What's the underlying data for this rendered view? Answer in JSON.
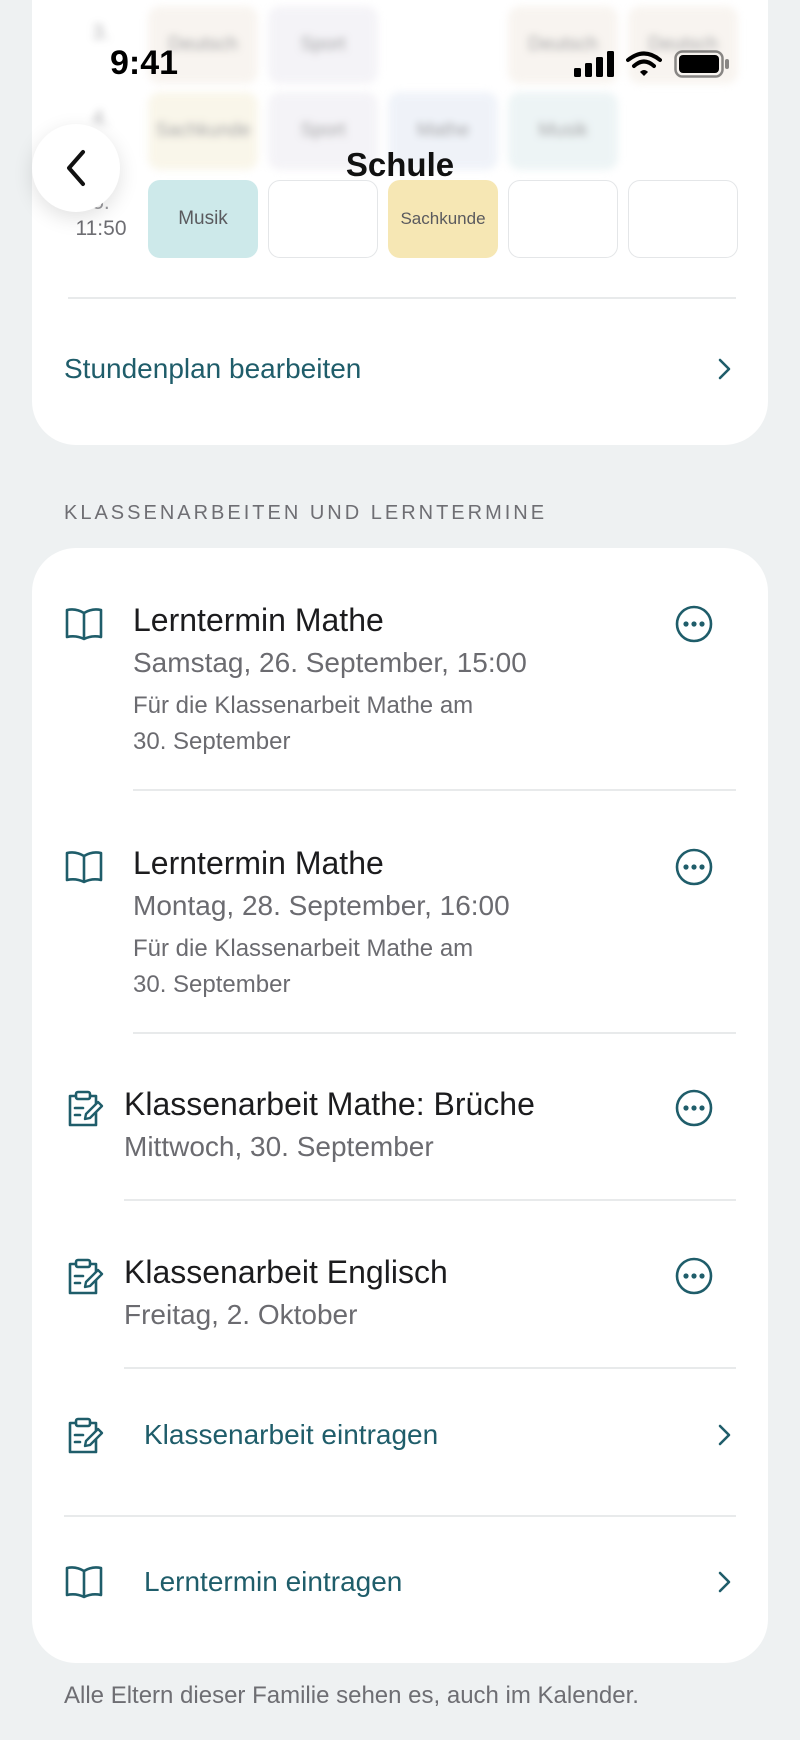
{
  "status_bar": {
    "time": "9:41"
  },
  "header": {
    "title": "Schule"
  },
  "timetable": {
    "rows": [
      {
        "num": "3.",
        "time": "",
        "cells": [
          "Deutsch",
          "Sport",
          "",
          "Deutsch",
          "Deutsch"
        ],
        "blurred": true
      },
      {
        "num": "4.",
        "time": "",
        "cells": [
          "Sachkunde",
          "Sport",
          "Mathe",
          "Musik",
          ""
        ],
        "blurred": true
      },
      {
        "num": "5.",
        "time": "11:50",
        "cells": [
          "Musik",
          "",
          "Sachkunde",
          "",
          ""
        ],
        "blurred": false
      }
    ],
    "edit_link": "Stundenplan bearbeiten"
  },
  "section": {
    "label": "KLASSENARBEITEN UND LERNTERMINE"
  },
  "events": [
    {
      "type": "lerntermin",
      "title": "Lerntermin Mathe",
      "date": "Samstag, 26. September, 15:00",
      "note_line1": "Für die Klassenarbeit Mathe am",
      "note_line2": "30. September"
    },
    {
      "type": "lerntermin",
      "title": "Lerntermin Mathe",
      "date": "Montag, 28. September, 16:00",
      "note_line1": "Für die Klassenarbeit Mathe am",
      "note_line2": "30. September"
    },
    {
      "type": "klassenarbeit",
      "title": "Klassenarbeit Mathe: Brüche",
      "date": "Mittwoch, 30. September"
    },
    {
      "type": "klassenarbeit",
      "title": "Klassenarbeit Englisch",
      "date": "Freitag, 2. Oktober"
    }
  ],
  "actions": {
    "add_exam": "Klassenarbeit eintragen",
    "add_study": "Lerntermin eintragen"
  },
  "footer": "Alle Eltern dieser Familie sehen es, auch im Kalender.",
  "colors": {
    "accent": "#1f5d6a",
    "background": "#eef1f2",
    "card": "#ffffff",
    "musik": "#cde9ea",
    "sachkunde": "#f6e7b4"
  }
}
